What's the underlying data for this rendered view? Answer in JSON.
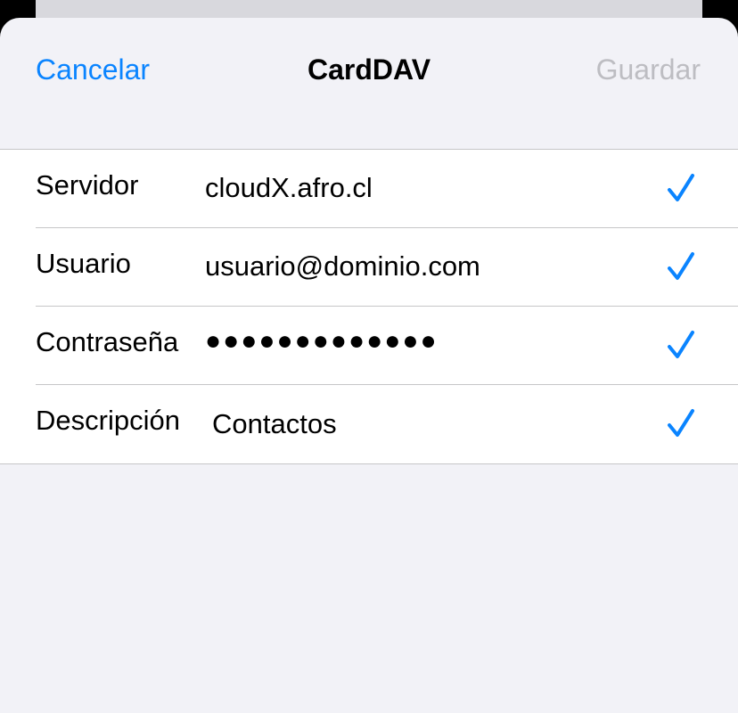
{
  "nav": {
    "cancel_label": "Cancelar",
    "title": "CardDAV",
    "save_label": "Guardar"
  },
  "form": {
    "rows": [
      {
        "label": "Servidor",
        "value": "cloudX.afro.cl",
        "icon": "checkmark-icon"
      },
      {
        "label": "Usuario",
        "value": "usuario@dominio.com",
        "icon": "checkmark-icon"
      },
      {
        "label": "Contraseña",
        "value": "●●●●●●●●●●●●●",
        "icon": "checkmark-icon"
      },
      {
        "label": "Descripción",
        "value": "Contactos",
        "icon": "checkmark-icon"
      }
    ]
  },
  "colors": {
    "accent": "#0a84ff",
    "disabled": "#bdbdc2",
    "background": "#f2f2f7",
    "separator": "#c6c6c8"
  }
}
